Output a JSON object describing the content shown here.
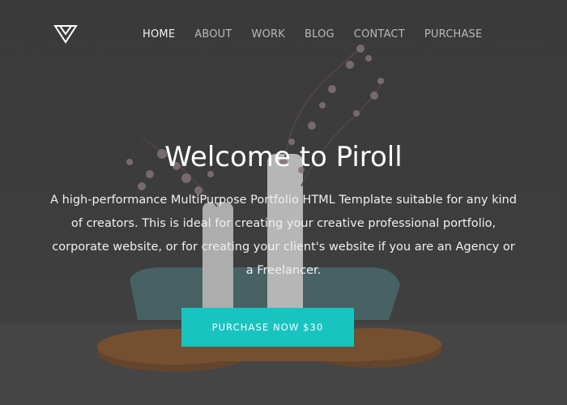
{
  "brand": {
    "logo_icon": "triangle-logo-icon"
  },
  "nav": {
    "items": [
      {
        "label": "HOME",
        "active": true
      },
      {
        "label": "ABOUT",
        "active": false
      },
      {
        "label": "WORK",
        "active": false
      },
      {
        "label": "BLOG",
        "active": false
      },
      {
        "label": "CONTACT",
        "active": false
      },
      {
        "label": "PURCHASE",
        "active": false
      }
    ]
  },
  "hero": {
    "title": "Welcome to Piroll",
    "description": "A high-performance MultiPurpose Portfolio HTML Template suitable for any kind of creators. This is ideal for creating your creative professional portfolio, corporate website, or for creating your client's website if you are an Agency or a Freelancer.",
    "cta_label": "PURCHASE NOW $30"
  },
  "colors": {
    "accent": "#17c4c0",
    "overlay": "#3e3e3e",
    "nav_active": "#f2f2f2",
    "nav_inactive": "#b9b9b9"
  }
}
